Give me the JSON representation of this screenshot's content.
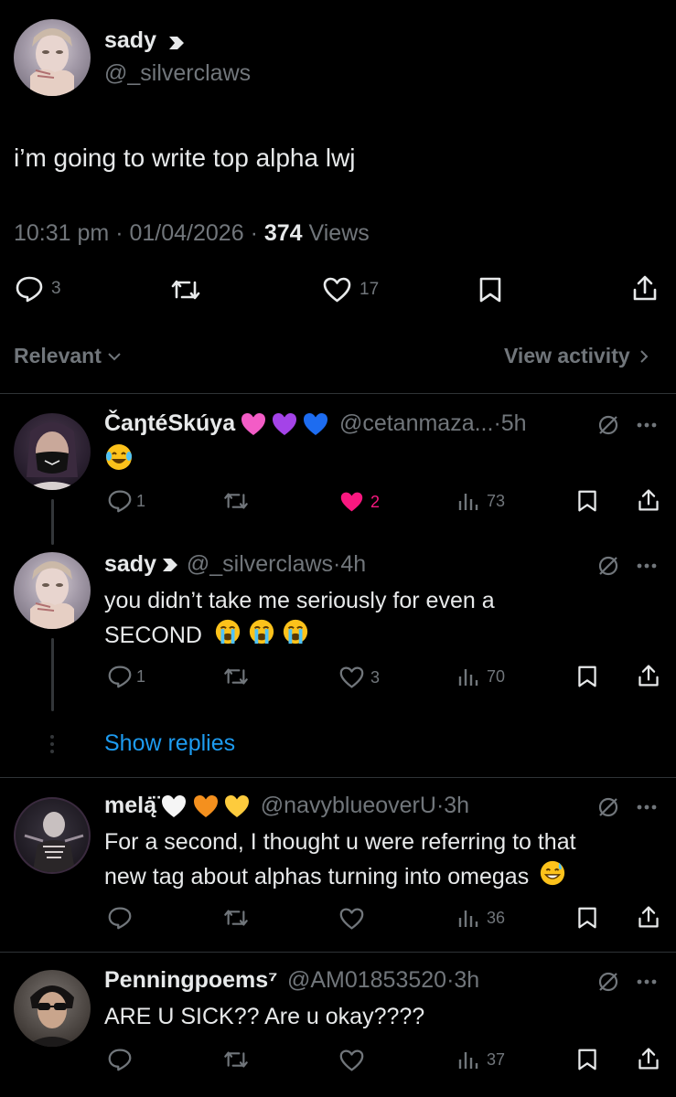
{
  "main_tweet": {
    "author_name": "sady",
    "author_handle": "@_silverclaws",
    "text": "i’m going to write top alpha lwj",
    "time": "10:31 pm",
    "date": "01/04/2026",
    "views_count": "374",
    "views_label": "Views",
    "replies": "3",
    "likes": "17"
  },
  "filter": {
    "relevant_label": "Relevant",
    "view_activity_label": "View activity"
  },
  "replies": [
    {
      "name": "ČaŋtéSkúya",
      "handle": "@cetanmaza...",
      "time": "5h",
      "text": "",
      "replies": "1",
      "likes": "2",
      "views": "73"
    },
    {
      "name": "sady",
      "handle": "@_silverclaws",
      "time": "4h",
      "text_line1": "you didn’t take me seriously for even a",
      "text_line2": "SECOND",
      "replies": "1",
      "likes": "3",
      "views": "70"
    },
    {
      "name": "melą̇̈",
      "handle": "@navyblueoverU",
      "time": "3h",
      "text_line1": "For a second, I thought u were referring to that",
      "text_line2": "new tag about alphas turning into omegas",
      "views": "36"
    },
    {
      "name": "Penningpoems⁷",
      "handle": "@AM01853520",
      "time": "3h",
      "text_line1": "ARE U SICK?? Are u okay????",
      "views": "37"
    }
  ],
  "show_replies_label": "Show replies",
  "dot_separator": "·",
  "colors": {
    "background": "#000000",
    "text": "#e7e9ea",
    "secondary": "#71767b",
    "link": "#1d9bf0",
    "like_active": "#f91880",
    "divider": "#2f3336"
  }
}
